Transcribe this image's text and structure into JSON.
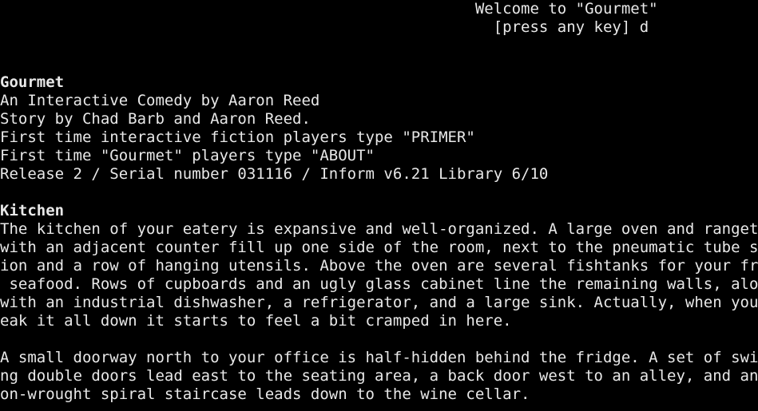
{
  "banner": {
    "welcome": "                                                    Welcome to \"Gourmet\"",
    "prompt_label": "                                                      [press any key] d"
  },
  "game_info": {
    "title": "Gourmet",
    "subtitle": "An Interactive Comedy by Aaron Reed",
    "story_by": "Story by Chad Barb and Aaron Reed.",
    "primer_hint": "First time interactive fiction players type \"PRIMER\"",
    "about_hint": "First time \"Gourmet\" players type \"ABOUT\"",
    "release": "Release 2 / Serial number 031116 / Inform v6.21 Library 6/10"
  },
  "room": {
    "name": "Kitchen",
    "description_lines": [
      "The kitchen of your eatery is expansive and well-organized. A large oven and rangetop",
      "with an adjacent counter fill up one side of the room, next to the pneumatic tube stat",
      "ion and a row of hanging utensils. Above the oven are several fishtanks for your fresh",
      " seafood. Rows of cupboards and an ugly glass cabinet line the remaining walls, along",
      "with an industrial dishwasher, a refrigerator, and a large sink. Actually, when you br",
      "eak it all down it starts to feel a bit cramped in here."
    ],
    "exits_lines": [
      "A small doorway north to your office is half-hidden behind the fridge. A set of swingi",
      "ng double doors lead east to the seating area, a back door west to an alley, and an ir",
      "on-wrought spiral staircase leads down to the wine cellar."
    ]
  },
  "colors": {
    "background": "#000000",
    "text": "#e8e8e8"
  }
}
